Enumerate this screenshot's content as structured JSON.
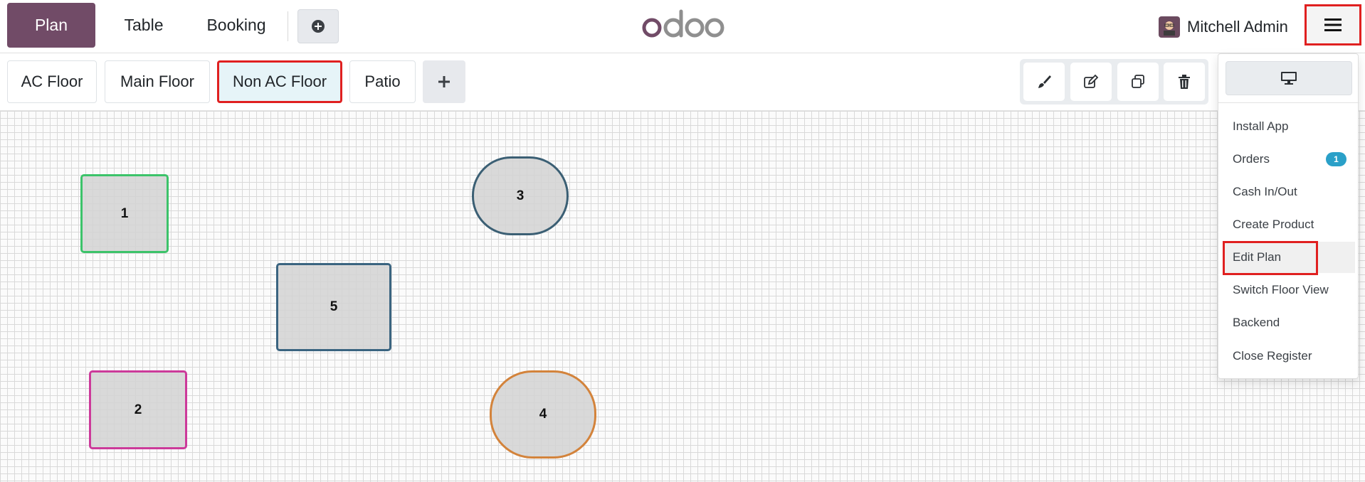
{
  "navbar": {
    "tabs": {
      "plan": "Plan",
      "table": "Table",
      "booking": "Booking"
    },
    "logo": "odoo",
    "user_name": "Mitchell Admin",
    "icons": [
      "plus-circle-icon",
      "avatar",
      "hamburger-icon"
    ]
  },
  "floors": {
    "tabs": [
      "AC Floor",
      "Main Floor",
      "Non AC Floor",
      "Patio"
    ],
    "active": "Non AC Floor"
  },
  "edit_tools": [
    "paintbrush-icon",
    "edit-icon",
    "duplicate-icon",
    "trash-icon"
  ],
  "tables": [
    {
      "label": "1",
      "shape": "square",
      "border_color": "#3cc36a"
    },
    {
      "label": "3",
      "shape": "round",
      "border_color": "#3b5f74"
    },
    {
      "label": "5",
      "shape": "square",
      "border_color": "#3a6480"
    },
    {
      "label": "2",
      "shape": "square",
      "border_color": "#cc3a9a"
    },
    {
      "label": "4",
      "shape": "round",
      "border_color": "#d3833b"
    }
  ],
  "menu": {
    "items": [
      "Install App",
      "Orders",
      "Cash In/Out",
      "Create Product",
      "Edit Plan",
      "Switch Floor View",
      "Backend",
      "Close Register"
    ],
    "orders_badge": "1",
    "highlighted": "Edit Plan"
  },
  "colors": {
    "brand": "#714b67",
    "highlight": "#e02020",
    "badge": "#2aa0c8"
  }
}
